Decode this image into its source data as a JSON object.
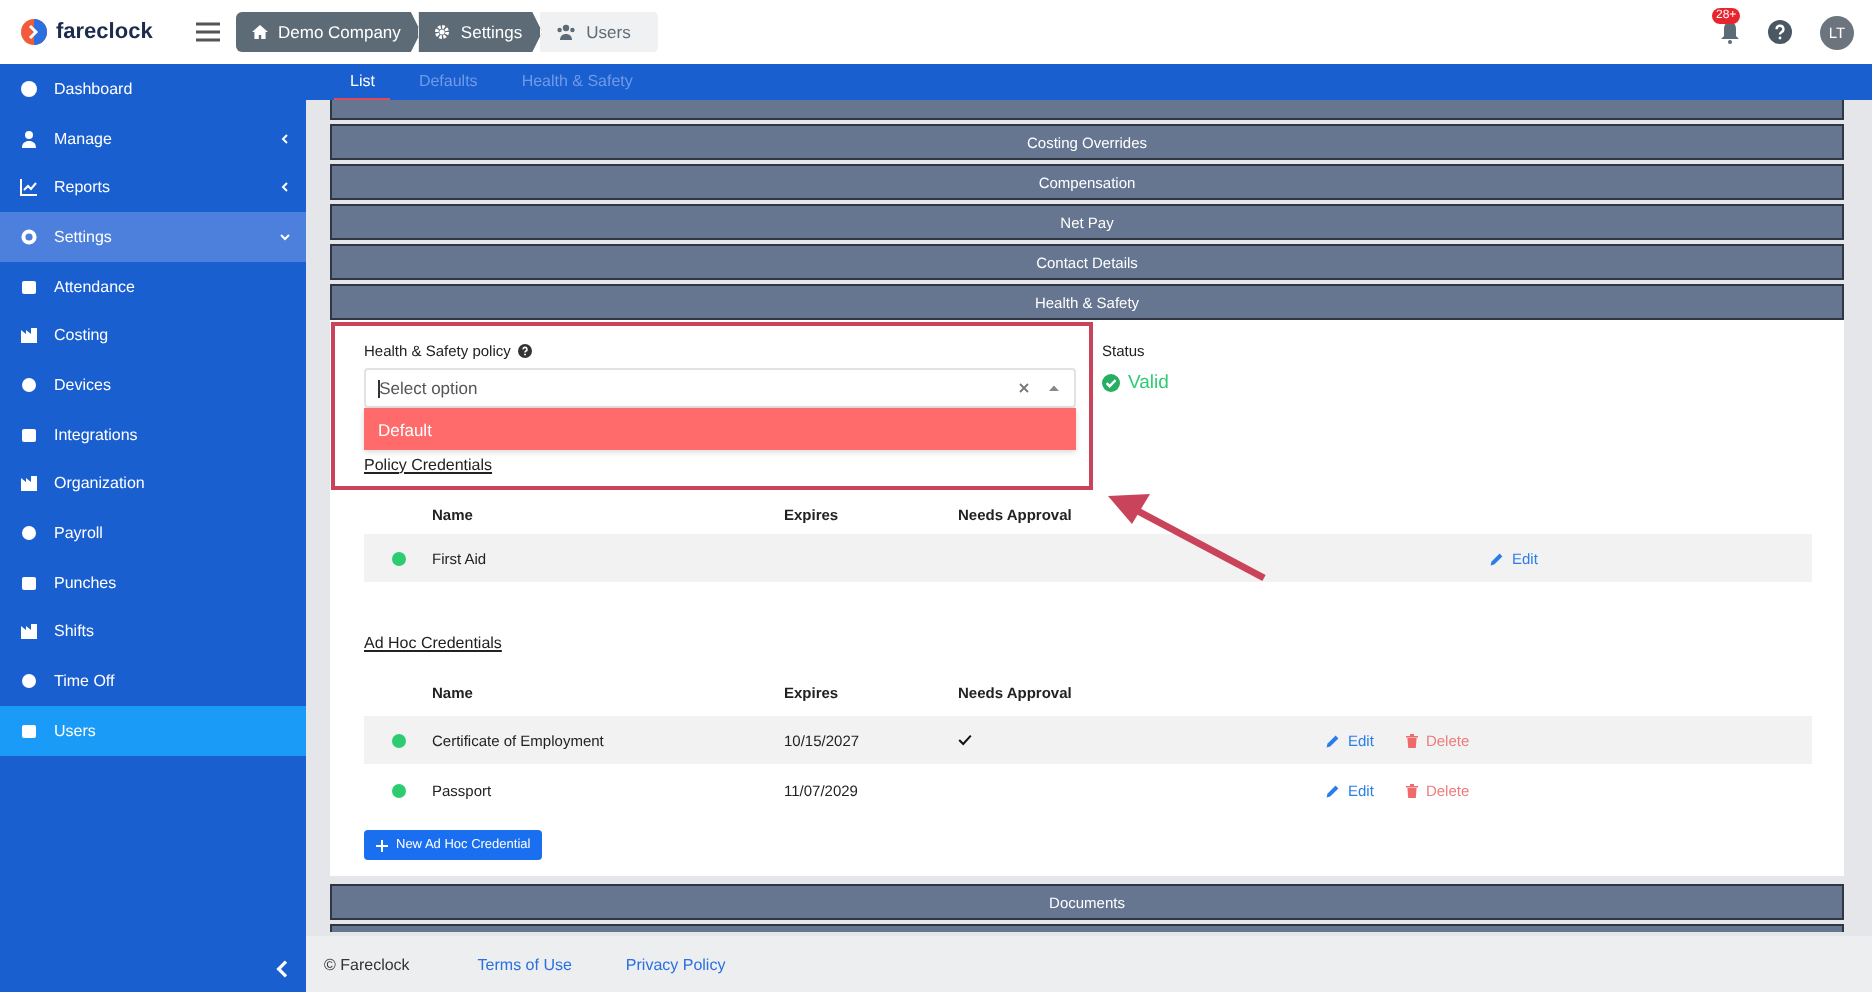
{
  "header": {
    "logo": "fareclock",
    "breadcrumbs": [
      {
        "label": "Demo Company",
        "current": false
      },
      {
        "label": "Settings",
        "current": false
      },
      {
        "label": "Users",
        "current": true
      }
    ],
    "notification_badge": "28+",
    "avatar": "LT"
  },
  "sidebar": {
    "items": [
      {
        "label": "Dashboard",
        "kind": "link",
        "selected": false
      },
      {
        "label": "Manage",
        "kind": "group",
        "expanded": false,
        "selected": false
      },
      {
        "label": "Reports",
        "kind": "group",
        "expanded": false,
        "selected": false
      },
      {
        "label": "Settings",
        "kind": "group",
        "expanded": true,
        "selected": false,
        "children": [
          {
            "label": "Attendance",
            "selected": false
          },
          {
            "label": "Costing",
            "selected": false
          },
          {
            "label": "Devices",
            "selected": false
          },
          {
            "label": "Integrations",
            "selected": false
          },
          {
            "label": "Organization",
            "selected": false
          },
          {
            "label": "Payroll",
            "selected": false
          },
          {
            "label": "Punches",
            "selected": false
          },
          {
            "label": "Shifts",
            "selected": false
          },
          {
            "label": "Time Off",
            "selected": false
          },
          {
            "label": "Users",
            "selected": true
          }
        ]
      }
    ]
  },
  "tabs": [
    {
      "label": "List",
      "selected": true
    },
    {
      "label": "Defaults",
      "selected": false
    },
    {
      "label": "Health & Safety",
      "selected": false
    }
  ],
  "sections_before": [
    {
      "title": "Costing Overrides",
      "expanded": false
    },
    {
      "title": "Compensation",
      "expanded": false
    },
    {
      "title": "Net Pay",
      "expanded": false
    },
    {
      "title": "Contact Details",
      "expanded": false
    },
    {
      "title": "Health & Safety",
      "expanded": true
    }
  ],
  "health_safety": {
    "policy_field": {
      "label": "Health & Safety policy",
      "placeholder": "Select option",
      "options": [
        {
          "label": "Default",
          "highlighted": true
        }
      ]
    },
    "status": {
      "label": "Status",
      "value": "Valid",
      "valid": true
    },
    "tables": [
      {
        "title": "Policy Credentials",
        "columns": [
          "Name",
          "Expires",
          "Needs Approval"
        ],
        "rows": [
          {
            "name": "First Aid",
            "expires": "",
            "needs_approval": false,
            "color": "#2ecc71",
            "actions": [
              {
                "kind": "edit",
                "label": "Edit"
              }
            ]
          }
        ]
      },
      {
        "title": "Ad Hoc Credentials",
        "columns": [
          "Name",
          "Expires",
          "Needs Approval"
        ],
        "rows": [
          {
            "name": "Certificate of Employment",
            "expires": "10/15/2027",
            "needs_approval": true,
            "color": "#2ecc71",
            "actions": [
              {
                "kind": "edit",
                "label": "Edit"
              },
              {
                "kind": "delete",
                "label": "Delete"
              }
            ]
          },
          {
            "name": "Passport",
            "expires": "11/07/2029",
            "needs_approval": false,
            "color": "#2ecc71",
            "actions": [
              {
                "kind": "edit",
                "label": "Edit"
              },
              {
                "kind": "delete",
                "label": "Delete"
              }
            ]
          }
        ]
      }
    ],
    "new_button": "New Ad Hoc Credential"
  },
  "sections_after": [
    {
      "title": "Documents",
      "expanded": false
    }
  ],
  "footer": {
    "copyright": "© Fareclock",
    "links": [
      "Terms of Use",
      "Privacy Policy"
    ]
  }
}
